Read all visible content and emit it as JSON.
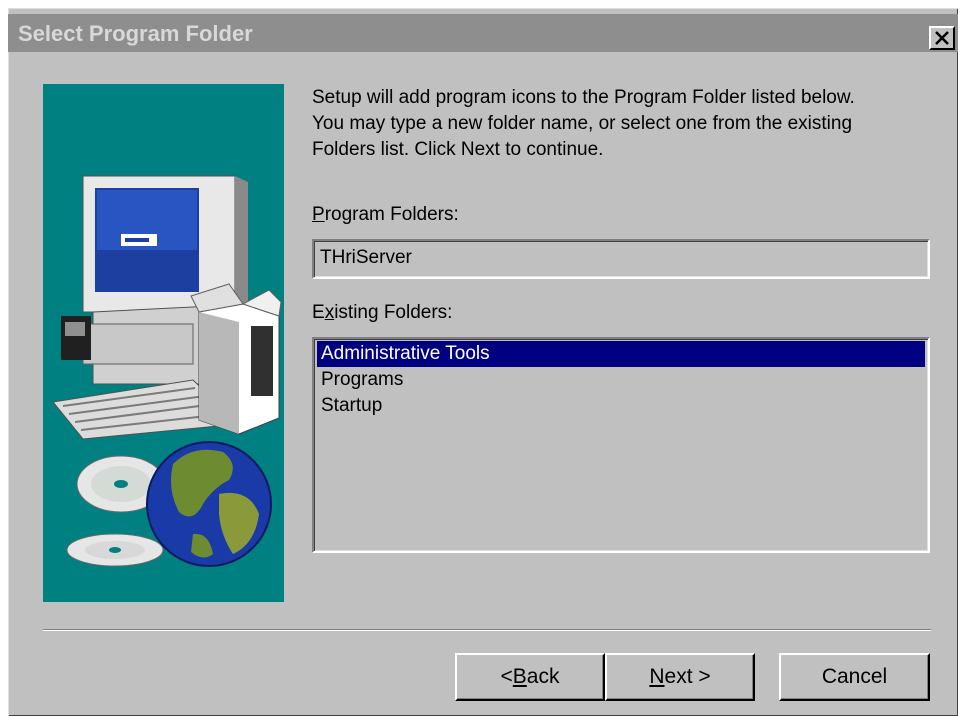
{
  "window": {
    "title": "Select Program Folder",
    "close_icon": "close-x-icon"
  },
  "artwork": {
    "icon": "computer-globe-cd-illustration",
    "background_color": "#008080"
  },
  "intro": {
    "line1": "Setup will add program icons to the Program Folder listed below.",
    "line2": "You may type a new folder name, or select one from the existing",
    "line3": "Folders list.  Click Next to continue."
  },
  "program_folder": {
    "label_mnemonic": "P",
    "label_rest": "rogram Folders:",
    "value": "THriServer"
  },
  "existing_folders": {
    "label_pre": "E",
    "label_mnemonic": "x",
    "label_rest": "isting Folders:",
    "items": [
      "Administrative Tools",
      "Programs",
      "Startup"
    ],
    "selected_index": 0,
    "selection_color": "#000080"
  },
  "buttons": {
    "back_pre": "< ",
    "back_mnemonic": "B",
    "back_rest": "ack",
    "next_mnemonic": "N",
    "next_rest": "ext >",
    "cancel": "Cancel"
  }
}
